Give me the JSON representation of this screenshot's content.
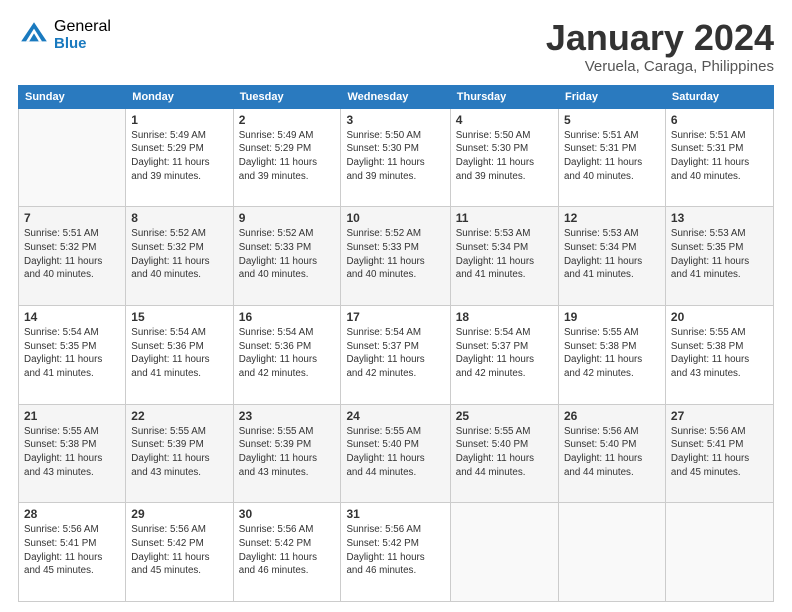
{
  "logo": {
    "general": "General",
    "blue": "Blue"
  },
  "title": "January 2024",
  "subtitle": "Veruela, Caraga, Philippines",
  "weekdays": [
    "Sunday",
    "Monday",
    "Tuesday",
    "Wednesday",
    "Thursday",
    "Friday",
    "Saturday"
  ],
  "weeks": [
    [
      {
        "day": "",
        "info": ""
      },
      {
        "day": "1",
        "info": "Sunrise: 5:49 AM\nSunset: 5:29 PM\nDaylight: 11 hours\nand 39 minutes."
      },
      {
        "day": "2",
        "info": "Sunrise: 5:49 AM\nSunset: 5:29 PM\nDaylight: 11 hours\nand 39 minutes."
      },
      {
        "day": "3",
        "info": "Sunrise: 5:50 AM\nSunset: 5:30 PM\nDaylight: 11 hours\nand 39 minutes."
      },
      {
        "day": "4",
        "info": "Sunrise: 5:50 AM\nSunset: 5:30 PM\nDaylight: 11 hours\nand 39 minutes."
      },
      {
        "day": "5",
        "info": "Sunrise: 5:51 AM\nSunset: 5:31 PM\nDaylight: 11 hours\nand 40 minutes."
      },
      {
        "day": "6",
        "info": "Sunrise: 5:51 AM\nSunset: 5:31 PM\nDaylight: 11 hours\nand 40 minutes."
      }
    ],
    [
      {
        "day": "7",
        "info": "Sunrise: 5:51 AM\nSunset: 5:32 PM\nDaylight: 11 hours\nand 40 minutes."
      },
      {
        "day": "8",
        "info": "Sunrise: 5:52 AM\nSunset: 5:32 PM\nDaylight: 11 hours\nand 40 minutes."
      },
      {
        "day": "9",
        "info": "Sunrise: 5:52 AM\nSunset: 5:33 PM\nDaylight: 11 hours\nand 40 minutes."
      },
      {
        "day": "10",
        "info": "Sunrise: 5:52 AM\nSunset: 5:33 PM\nDaylight: 11 hours\nand 40 minutes."
      },
      {
        "day": "11",
        "info": "Sunrise: 5:53 AM\nSunset: 5:34 PM\nDaylight: 11 hours\nand 41 minutes."
      },
      {
        "day": "12",
        "info": "Sunrise: 5:53 AM\nSunset: 5:34 PM\nDaylight: 11 hours\nand 41 minutes."
      },
      {
        "day": "13",
        "info": "Sunrise: 5:53 AM\nSunset: 5:35 PM\nDaylight: 11 hours\nand 41 minutes."
      }
    ],
    [
      {
        "day": "14",
        "info": "Sunrise: 5:54 AM\nSunset: 5:35 PM\nDaylight: 11 hours\nand 41 minutes."
      },
      {
        "day": "15",
        "info": "Sunrise: 5:54 AM\nSunset: 5:36 PM\nDaylight: 11 hours\nand 41 minutes."
      },
      {
        "day": "16",
        "info": "Sunrise: 5:54 AM\nSunset: 5:36 PM\nDaylight: 11 hours\nand 42 minutes."
      },
      {
        "day": "17",
        "info": "Sunrise: 5:54 AM\nSunset: 5:37 PM\nDaylight: 11 hours\nand 42 minutes."
      },
      {
        "day": "18",
        "info": "Sunrise: 5:54 AM\nSunset: 5:37 PM\nDaylight: 11 hours\nand 42 minutes."
      },
      {
        "day": "19",
        "info": "Sunrise: 5:55 AM\nSunset: 5:38 PM\nDaylight: 11 hours\nand 42 minutes."
      },
      {
        "day": "20",
        "info": "Sunrise: 5:55 AM\nSunset: 5:38 PM\nDaylight: 11 hours\nand 43 minutes."
      }
    ],
    [
      {
        "day": "21",
        "info": "Sunrise: 5:55 AM\nSunset: 5:38 PM\nDaylight: 11 hours\nand 43 minutes."
      },
      {
        "day": "22",
        "info": "Sunrise: 5:55 AM\nSunset: 5:39 PM\nDaylight: 11 hours\nand 43 minutes."
      },
      {
        "day": "23",
        "info": "Sunrise: 5:55 AM\nSunset: 5:39 PM\nDaylight: 11 hours\nand 43 minutes."
      },
      {
        "day": "24",
        "info": "Sunrise: 5:55 AM\nSunset: 5:40 PM\nDaylight: 11 hours\nand 44 minutes."
      },
      {
        "day": "25",
        "info": "Sunrise: 5:55 AM\nSunset: 5:40 PM\nDaylight: 11 hours\nand 44 minutes."
      },
      {
        "day": "26",
        "info": "Sunrise: 5:56 AM\nSunset: 5:40 PM\nDaylight: 11 hours\nand 44 minutes."
      },
      {
        "day": "27",
        "info": "Sunrise: 5:56 AM\nSunset: 5:41 PM\nDaylight: 11 hours\nand 45 minutes."
      }
    ],
    [
      {
        "day": "28",
        "info": "Sunrise: 5:56 AM\nSunset: 5:41 PM\nDaylight: 11 hours\nand 45 minutes."
      },
      {
        "day": "29",
        "info": "Sunrise: 5:56 AM\nSunset: 5:42 PM\nDaylight: 11 hours\nand 45 minutes."
      },
      {
        "day": "30",
        "info": "Sunrise: 5:56 AM\nSunset: 5:42 PM\nDaylight: 11 hours\nand 46 minutes."
      },
      {
        "day": "31",
        "info": "Sunrise: 5:56 AM\nSunset: 5:42 PM\nDaylight: 11 hours\nand 46 minutes."
      },
      {
        "day": "",
        "info": ""
      },
      {
        "day": "",
        "info": ""
      },
      {
        "day": "",
        "info": ""
      }
    ]
  ]
}
